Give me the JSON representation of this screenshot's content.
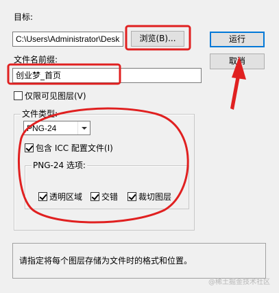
{
  "target": {
    "label": "目标:",
    "path_value": "C:\\Users\\Administrator\\Desk",
    "browse_label": "浏览(B)..."
  },
  "buttons": {
    "run_label": "运行",
    "cancel_label": "取消"
  },
  "prefix": {
    "label": "文件名前缀:",
    "value": "创业梦_首页"
  },
  "visible_only": {
    "label": "仅限可见图层(V)",
    "checked": false
  },
  "file_type": {
    "group_title": "文件类型:",
    "selected": "PNG-24",
    "icc_label": "包含 ICC 配置文件(I)",
    "icc_checked": true
  },
  "png_options": {
    "group_title": "PNG-24 选项:",
    "transparency_label": "透明区域",
    "interlaced_label": "交错",
    "trim_label": "裁切图层"
  },
  "description": "请指定将每个图层存储为文件时的格式和位置。",
  "watermark": "@稀土掘金技术社区",
  "colors": {
    "annotation_red": "#e02020",
    "focus_blue": "#0078d7"
  }
}
